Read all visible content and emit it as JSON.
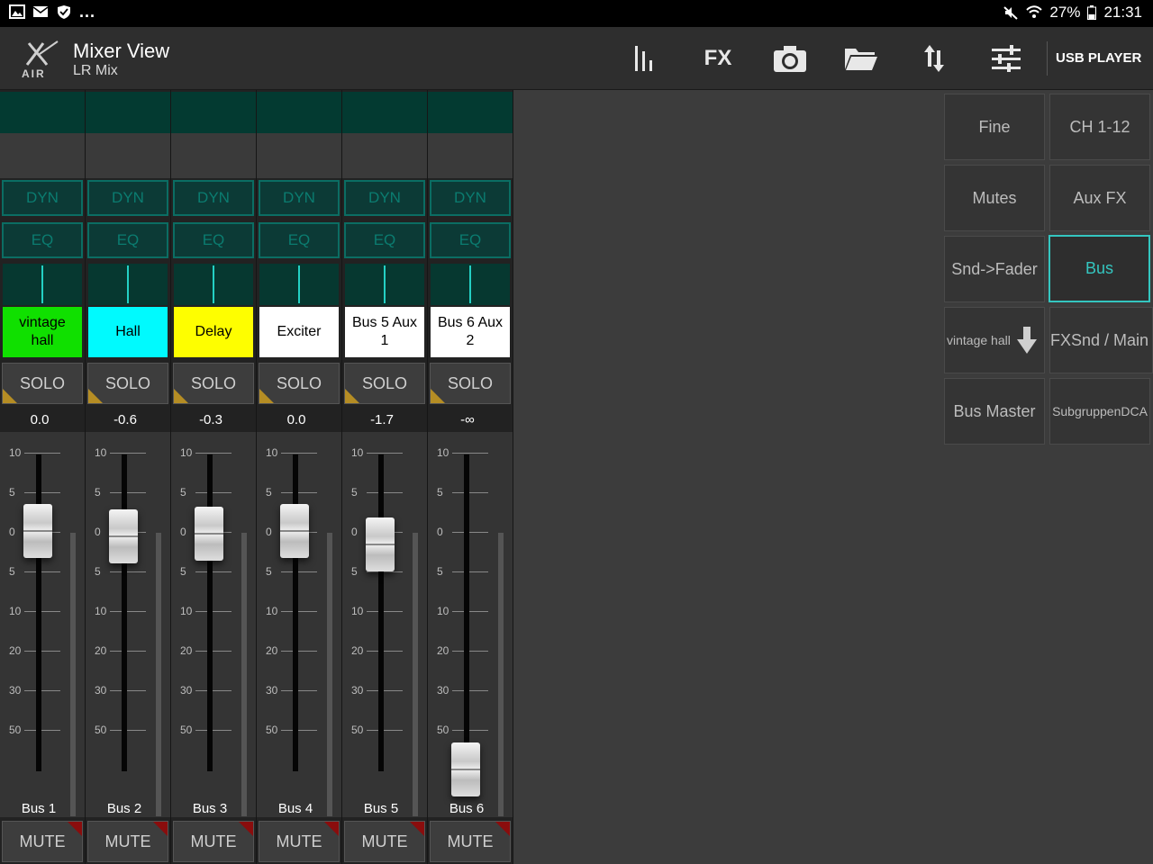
{
  "status_bar": {
    "dots": "...",
    "battery": "27%",
    "time": "21:31"
  },
  "header": {
    "title": "Mixer View",
    "subtitle": "LR Mix",
    "fx_label": "FX",
    "usb_label": "USB PLAYER"
  },
  "strip_labels": {
    "dyn": "DYN",
    "eq": "EQ",
    "solo": "SOLO",
    "mute": "MUTE"
  },
  "scale": [
    "10",
    "5",
    "0",
    "5",
    "10",
    "20",
    "30",
    "50"
  ],
  "strips": [
    {
      "name_line1": "vintage",
      "name_line2": "hall",
      "color": "#10e000",
      "gain": "0.0",
      "bus": "Bus 1",
      "fader_level_db": 0.0
    },
    {
      "name_line1": "Hall",
      "name_line2": "",
      "color": "#00fafe",
      "gain": "-0.6",
      "bus": "Bus 2",
      "fader_level_db": -0.6
    },
    {
      "name_line1": "Delay",
      "name_line2": "",
      "color": "#fefe00",
      "gain": "-0.3",
      "bus": "Bus 3",
      "fader_level_db": -0.3
    },
    {
      "name_line1": "Exciter",
      "name_line2": "",
      "color": "#ffffff",
      "gain": "0.0",
      "bus": "Bus 4",
      "fader_level_db": 0.0
    },
    {
      "name_line1": "Bus 5 Aux",
      "name_line2": "1",
      "color": "#ffffff",
      "gain": "-1.7",
      "bus": "Bus 5",
      "fader_level_db": -1.7
    },
    {
      "name_line1": "Bus 6 Aux",
      "name_line2": "2",
      "color": "#ffffff",
      "gain": "-∞",
      "bus": "Bus 6",
      "fader_level_db": null
    }
  ],
  "side_panel": {
    "fine": "Fine",
    "ch": "CH 1-12",
    "mutes": "Mutes",
    "aux_fx": "Aux  FX",
    "snd_fader": "Snd->Fader",
    "bus": "Bus",
    "vintage_hall": "vintage hall",
    "fxsnd_main": "FXSnd / Main",
    "bus_master": "Bus Master",
    "subgruppen": "SubgruppenDCA"
  },
  "colors": {
    "accent": "#34c6c0",
    "solo_corner": "#b58d24",
    "mute_corner": "#8a0d0d"
  }
}
